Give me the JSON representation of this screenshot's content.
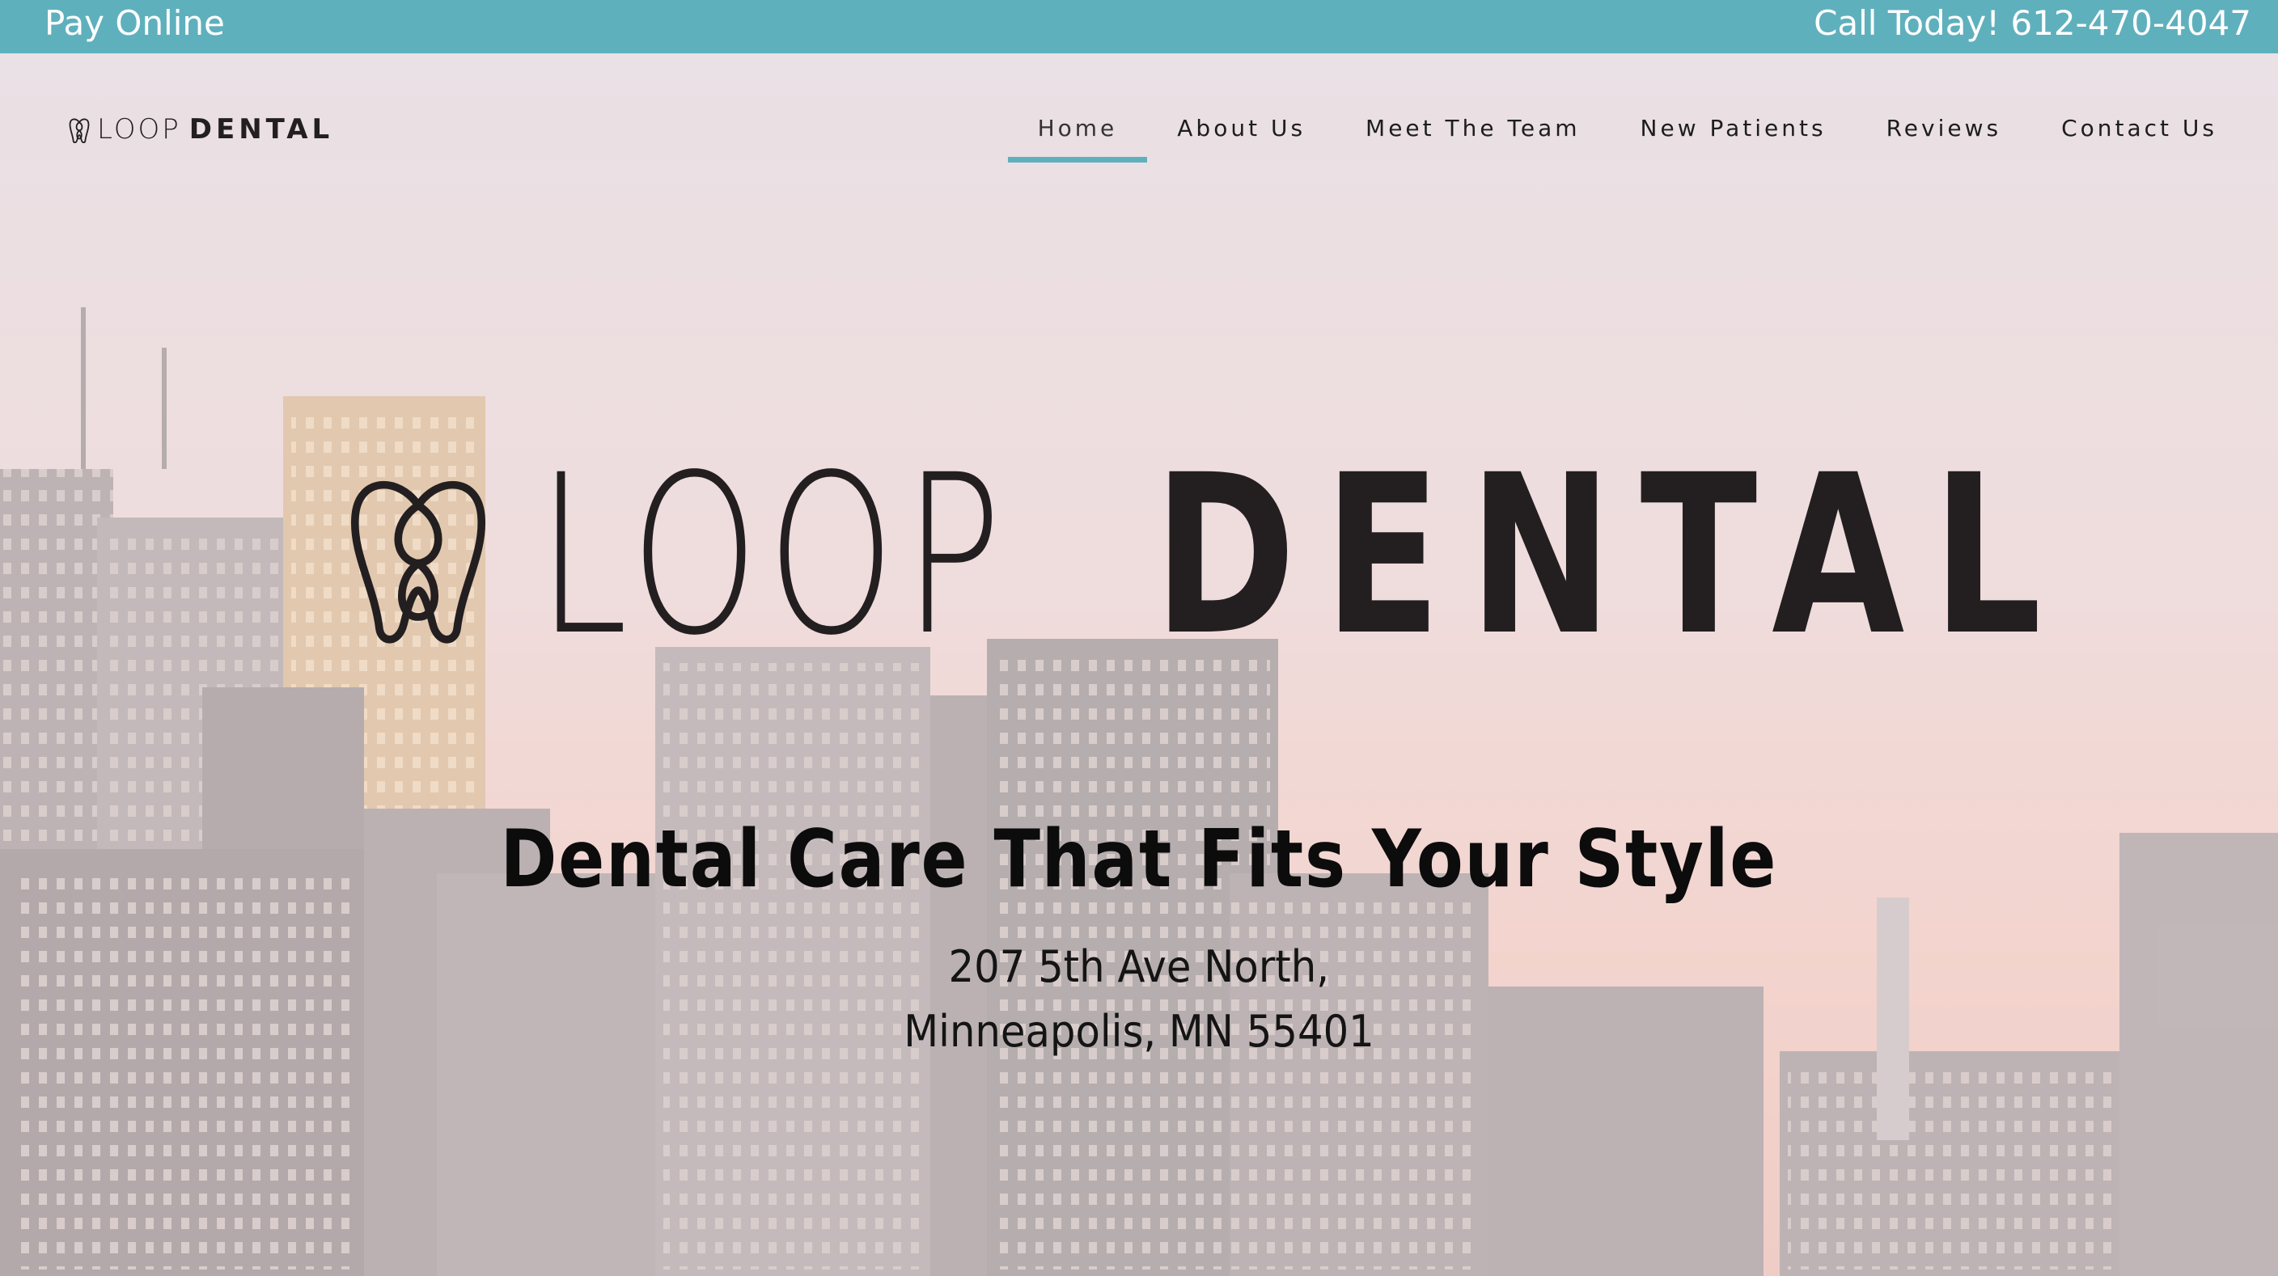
{
  "topbar": {
    "pay_label": "Pay Online",
    "call_label": "Call Today! 612-470-4047"
  },
  "brand": {
    "loop": "LOOP",
    "dental": "DENTAL"
  },
  "nav": {
    "items": [
      {
        "label": "Home",
        "active": true
      },
      {
        "label": "About Us"
      },
      {
        "label": "Meet The Team"
      },
      {
        "label": "New Patients"
      },
      {
        "label": "Reviews"
      },
      {
        "label": "Contact Us"
      }
    ]
  },
  "hero": {
    "tagline": "Dental Care That Fits Your Style",
    "address_line1": "207 5th Ave North,",
    "address_line2": "Minneapolis, MN 55401"
  },
  "colors": {
    "accent": "#5fb0bd",
    "text_dark": "#231f20"
  },
  "icons": {
    "logo_mark": "tooth-loop-icon"
  }
}
